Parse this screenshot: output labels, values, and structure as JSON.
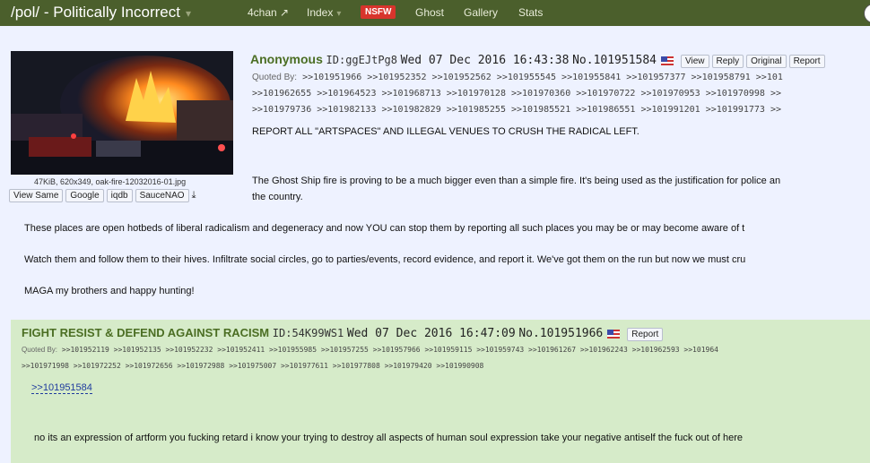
{
  "topbar": {
    "board_title": "/pol/ - Politically Incorrect",
    "nav_4chan": "4chan",
    "nav_index": "Index",
    "nav_nsfw": "NSFW",
    "nav_ghost": "Ghost",
    "nav_gallery": "Gallery",
    "nav_stats": "Stats"
  },
  "op": {
    "file_info": "47KiB, 620x349, oak-fire-12032016-01.jpg",
    "file_buttons": [
      "View Same",
      "Google",
      "iqdb",
      "SauceNAO"
    ],
    "name": "Anonymous",
    "id": "ID:ggEJtPg8",
    "datetime": "Wed 07 Dec 2016 16:43:38",
    "postno": "No.101951584",
    "btn_view": "View",
    "btn_reply": "Reply",
    "btn_original": "Original",
    "btn_report": "Report",
    "quoted_label": "Quoted By:",
    "quoted_line1": ">>101951966 >>101952352 >>101952562 >>101955545 >>101955841 >>101957377 >>101958791 >>101",
    "quoted_line2": ">>101962655 >>101964523 >>101968713 >>101970128 >>101970360 >>101970722 >>101970953 >>101970998 >>",
    "quoted_line3": ">>101979736 >>101982133 >>101982829 >>101985255 >>101985521 >>101986551 >>101991201 >>101991773 >>",
    "subject": "REPORT ALL \"ARTSPACES\" AND ILLEGAL VENUES TO CRUSH THE RADICAL LEFT.",
    "body1a": "The Ghost Ship fire is proving to be a much bigger even than a simple fire. It's being used as the justification for police an",
    "body1b": "the country.",
    "body2": "These places are open hotbeds of liberal radicalism and degeneracy and now YOU can stop them by reporting all such places you may be or may become aware of t",
    "body3": "Watch them and follow them to their hives. Infiltrate social circles, go to parties/events, record evidence, and report it. We've got them on the run but now we must cru",
    "body4": "MAGA my brothers and happy hunting!"
  },
  "reply": {
    "name": "FIGHT RESIST & DEFEND AGAINST RACISM",
    "id": "ID:54K99WS1",
    "datetime": "Wed 07 Dec 2016 16:47:09",
    "postno": "No.101951966",
    "btn_report": "Report",
    "quoted_label": "Quoted By:",
    "quoted_line1": ">>101952119 >>101952135 >>101952232 >>101952411 >>101955985 >>101957255 >>101957966 >>101959115 >>101959743 >>101961267 >>101962243 >>101962593 >>101964",
    "quoted_line2": ">>101971998 >>101972252 >>101972656 >>101972988 >>101975007 >>101977611 >>101977808 >>101979420 >>101990908",
    "quote_link": ">>101951584",
    "body": "no its an expression of artform you fucking retard i know your trying to destroy all aspects of human soul expression take your negative antiself the fuck out of here"
  },
  "icons": [
    "external-link-icon",
    "download-icon",
    "us-flag-icon",
    "avatar-icon"
  ]
}
